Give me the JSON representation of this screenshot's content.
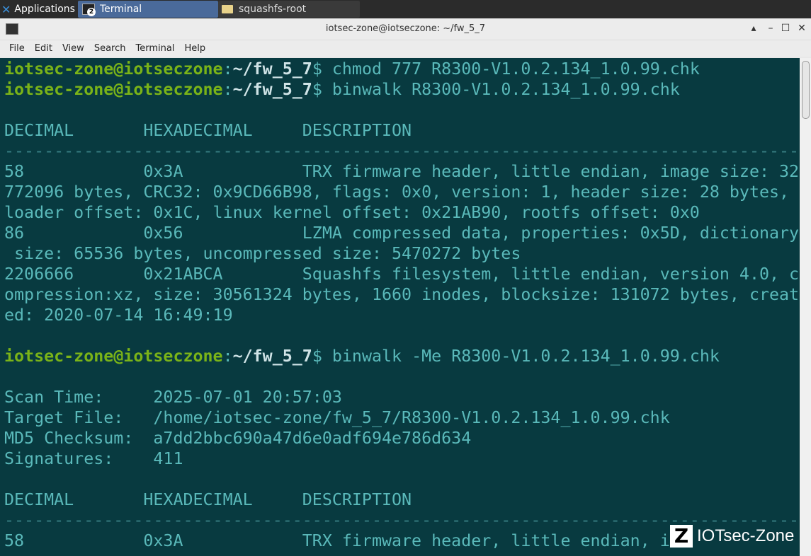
{
  "taskbar": {
    "app_menu": "Applications",
    "tasks": [
      {
        "label": "Terminal",
        "badge": "2",
        "icon": "terminal-icon"
      },
      {
        "label": "squashfs-root",
        "icon": "folder-icon"
      }
    ]
  },
  "window": {
    "title": "iotsec-zone@iotseczone: ~/fw_5_7",
    "controls": {
      "up": "▴",
      "minimize": "–",
      "maximize": "☐",
      "close": "✕"
    }
  },
  "menubar": [
    "File",
    "Edit",
    "View",
    "Search",
    "Terminal",
    "Help"
  ],
  "terminal": {
    "prompt": {
      "user": "iotsec-zone@iotseczone",
      "colon": ":",
      "path": "~/fw_5_7",
      "sign": "$"
    },
    "lines": [
      {
        "type": "cmd",
        "text": " chmod 777 R8300-V1.0.2.134_1.0.99.chk"
      },
      {
        "type": "cmd",
        "text": " binwalk R8300-V1.0.2.134_1.0.99.chk"
      },
      {
        "type": "out",
        "text": ""
      },
      {
        "type": "out",
        "text": "DECIMAL       HEXADECIMAL     DESCRIPTION"
      },
      {
        "type": "dash",
        "text": "--------------------------------------------------------------------------------"
      },
      {
        "type": "out",
        "text": "58            0x3A            TRX firmware header, little endian, image size: 32"
      },
      {
        "type": "out",
        "text": "772096 bytes, CRC32: 0x9CD66B98, flags: 0x0, version: 1, header size: 28 bytes,"
      },
      {
        "type": "out",
        "text": "loader offset: 0x1C, linux kernel offset: 0x21AB90, rootfs offset: 0x0"
      },
      {
        "type": "out",
        "text": "86            0x56            LZMA compressed data, properties: 0x5D, dictionary"
      },
      {
        "type": "out",
        "text": " size: 65536 bytes, uncompressed size: 5470272 bytes"
      },
      {
        "type": "out",
        "text": "2206666       0x21ABCA        Squashfs filesystem, little endian, version 4.0, c"
      },
      {
        "type": "out",
        "text": "ompression:xz, size: 30561324 bytes, 1660 inodes, blocksize: 131072 bytes, creat"
      },
      {
        "type": "out",
        "text": "ed: 2020-07-14 16:49:19"
      },
      {
        "type": "out",
        "text": ""
      },
      {
        "type": "cmd",
        "text": " binwalk -Me R8300-V1.0.2.134_1.0.99.chk"
      },
      {
        "type": "out",
        "text": ""
      },
      {
        "type": "out",
        "text": "Scan Time:     2025-07-01 20:57:03"
      },
      {
        "type": "out",
        "text": "Target File:   /home/iotsec-zone/fw_5_7/R8300-V1.0.2.134_1.0.99.chk"
      },
      {
        "type": "out",
        "text": "MD5 Checksum:  a7dd2bbc690a47d6e0adf694e786d634"
      },
      {
        "type": "out",
        "text": "Signatures:    411"
      },
      {
        "type": "out",
        "text": ""
      },
      {
        "type": "out",
        "text": "DECIMAL       HEXADECIMAL     DESCRIPTION"
      },
      {
        "type": "dash",
        "text": "--------------------------------------------------------------------------------"
      },
      {
        "type": "out",
        "text": "58            0x3A            TRX firmware header, little endian, im"
      }
    ]
  },
  "watermark": {
    "logo": "Z",
    "text": "IOTsec-Zone"
  }
}
